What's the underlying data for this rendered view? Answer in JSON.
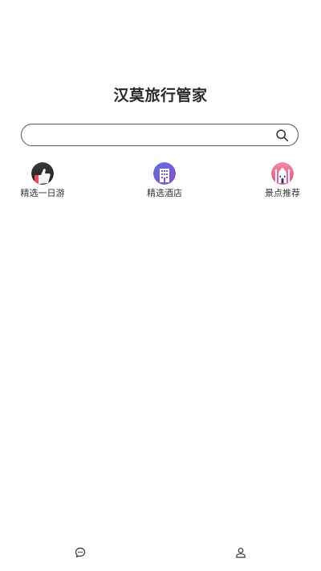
{
  "header": {
    "title": "汉莫旅行管家"
  },
  "search": {
    "value": "",
    "placeholder": "",
    "icon": "search-icon"
  },
  "categories": [
    {
      "label": "精选一日游",
      "icon": "thumbs-up-icon",
      "color": "#2b2b2b"
    },
    {
      "label": "精选酒店",
      "icon": "hotel-building-icon",
      "color": "#7b5bd6"
    },
    {
      "label": "景点推荐",
      "icon": "mosque-landmark-icon",
      "color": "#e86a92"
    }
  ],
  "tabbar": {
    "items": [
      {
        "icon": "chat-bubble-icon"
      },
      {
        "icon": "user-profile-icon"
      }
    ]
  },
  "colors": {
    "background": "#ffffff",
    "text": "#222222",
    "search_border": "#555555"
  }
}
